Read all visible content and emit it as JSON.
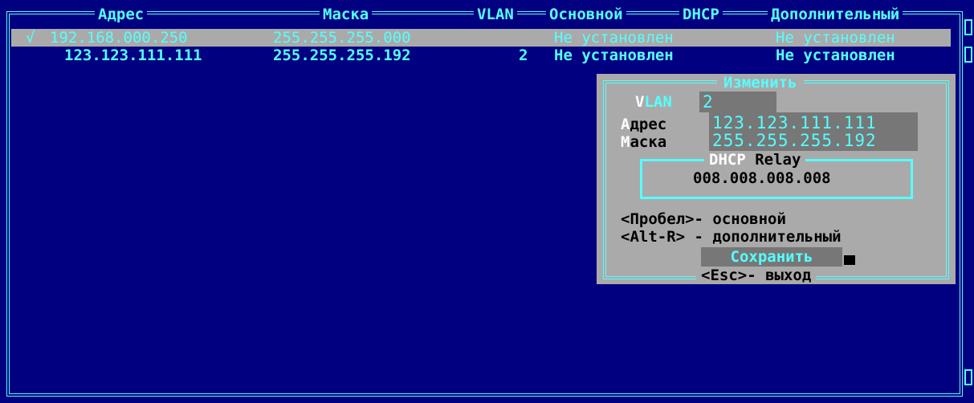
{
  "header": {
    "col_address": "Адрес",
    "col_mask": "Маска",
    "col_vlan": "VLAN",
    "col_primary": "Основной",
    "col_dhcp": "DHCP",
    "col_secondary": "Дополнительный"
  },
  "rows": [
    {
      "marker": "√",
      "address": "192.168.000.250",
      "mask": "255.255.255.000",
      "vlan": "",
      "primary_dhcp": "Не установлен",
      "secondary_dhcp": "Не установлен",
      "selected": true
    },
    {
      "marker": "",
      "address": "123.123.111.111",
      "mask": "255.255.255.192",
      "vlan": "2",
      "primary_dhcp": "Не установлен",
      "secondary_dhcp": "Не установлен",
      "selected": false
    }
  ],
  "dialog": {
    "title": "Изменить",
    "vlan_hotkey": "V",
    "vlan_label_rest": "LAN",
    "vlan_value": "2",
    "address_hotkey": "А",
    "address_label_rest": "дрес",
    "address_value": "123.123.111.111",
    "mask_hotkey": "М",
    "mask_label_rest": "аска",
    "mask_value": "255.255.255.192",
    "relay_title_hot": "DHCP",
    "relay_title_rest": " Relay",
    "relay_value": "008.008.008.008",
    "hint_space": "<Пробел>- основной",
    "hint_alt_r": "<Alt-R> - дополнительный",
    "save_label": "Сохранить",
    "esc_label": "<Esc>- выход"
  },
  "colors": {
    "background": "#000080",
    "accent": "#55ffff",
    "dialog_bg": "#aaaaaa",
    "field_bg": "#777777"
  }
}
